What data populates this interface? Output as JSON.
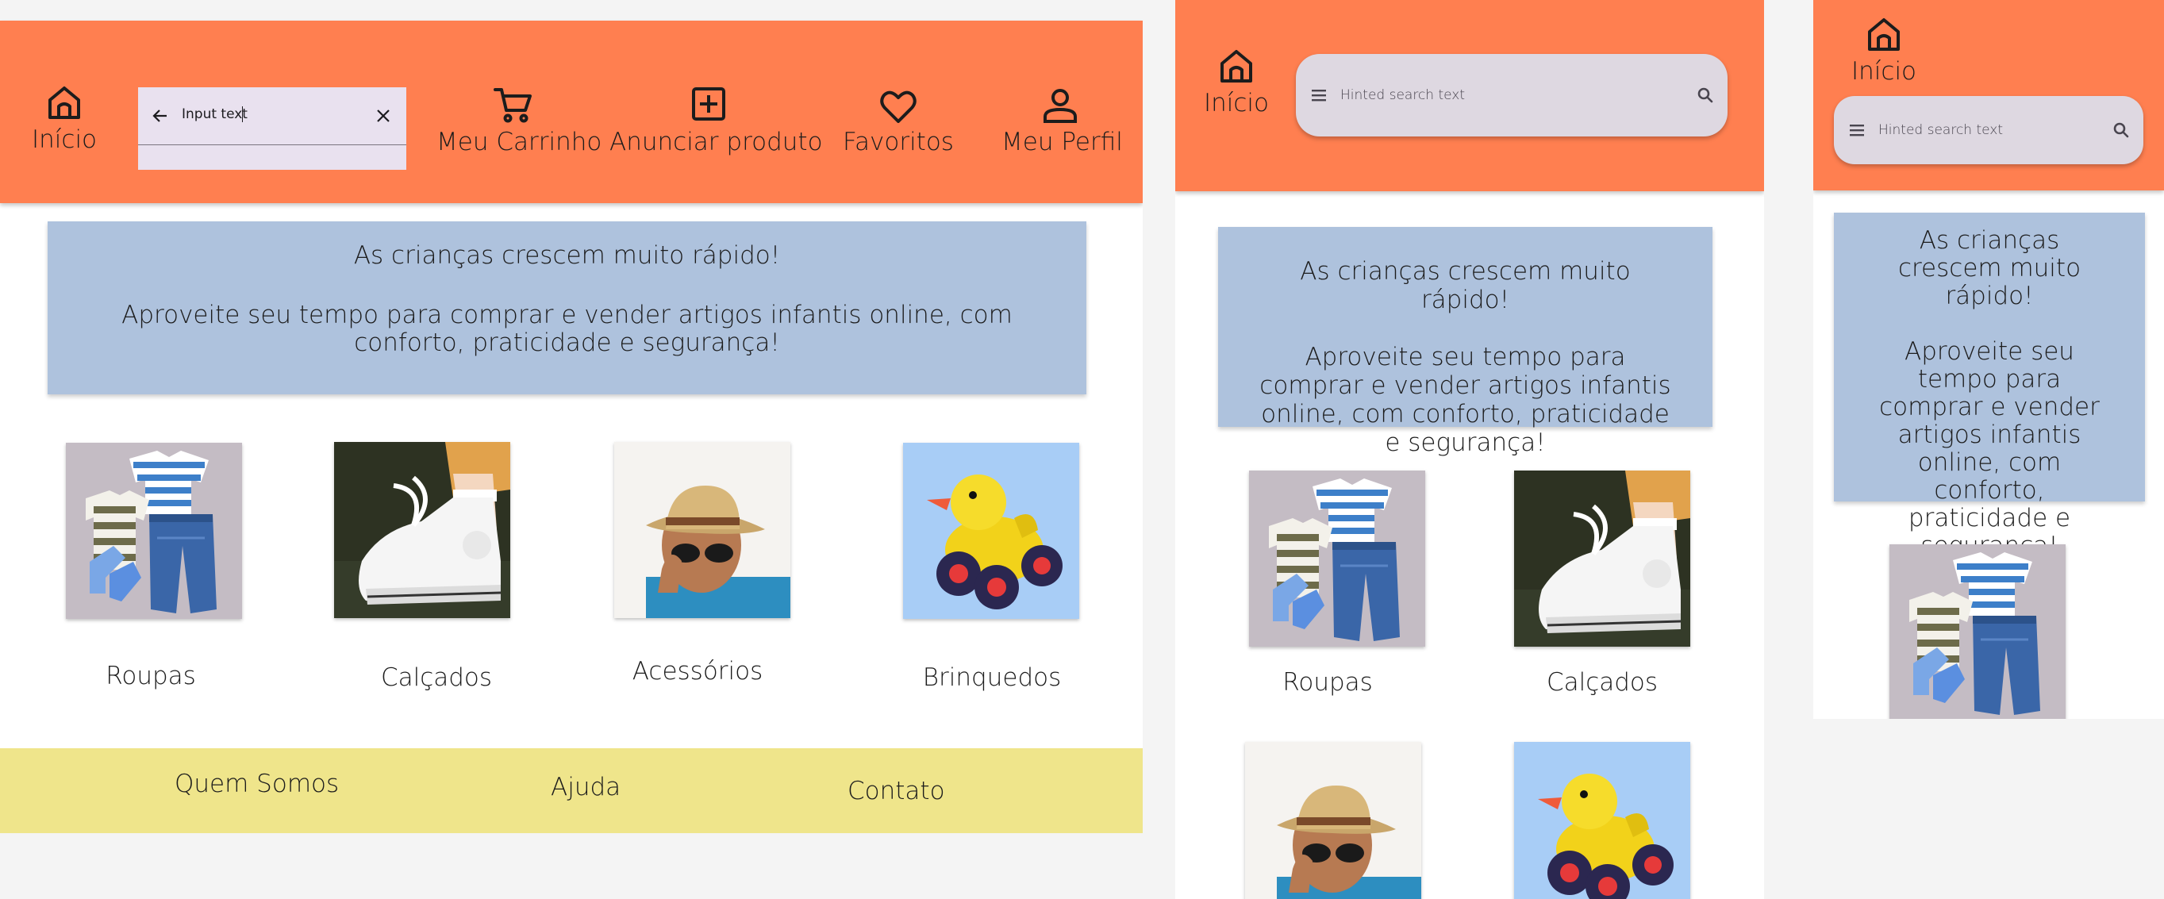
{
  "nav": {
    "home": "Início",
    "cart": "Meu Carrinho",
    "sell": "Anunciar produto",
    "favorites": "Favoritos",
    "profile": "Meu Perfil"
  },
  "search": {
    "input_value": "Input text",
    "hint": "Hinted search text"
  },
  "banner": {
    "headline": "As crianças crescem muito rápido!",
    "body": "Aproveite seu tempo para comprar e vender artigos infantis online, com conforto, praticidade e segurança!"
  },
  "categories": [
    {
      "label": "Roupas",
      "image": "clothes-photo"
    },
    {
      "label": "Calçados",
      "image": "shoe-photo"
    },
    {
      "label": "Acessórios",
      "image": "hat-boy-photo"
    },
    {
      "label": "Brinquedos",
      "image": "duck-toy-photo"
    }
  ],
  "footer": {
    "about": "Quem Somos",
    "help": "Ajuda",
    "contact": "Contato"
  },
  "colors": {
    "header": "#ff7f50",
    "banner": "#aec2dd",
    "footer": "#efe58b",
    "search": "#e9e1ef"
  },
  "icons": [
    "home-icon",
    "arrow-left-icon",
    "close-icon",
    "cart-icon",
    "add-box-icon",
    "heart-icon",
    "person-icon",
    "menu-icon",
    "search-icon"
  ]
}
